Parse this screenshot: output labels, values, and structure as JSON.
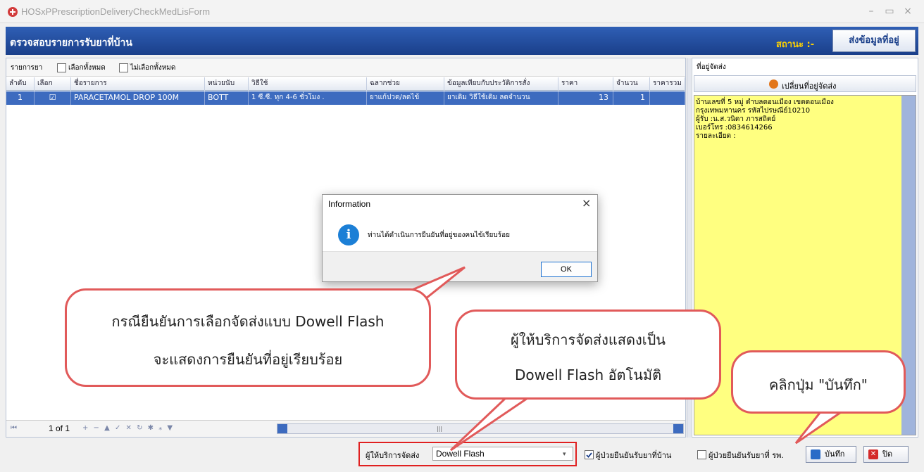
{
  "window": {
    "title": "HOSxPPrescriptionDeliveryCheckMedLisForm",
    "controls": [
      "–",
      "▭",
      "×"
    ]
  },
  "header": {
    "title": "ตรวจสอบรายการรับยาที่บ้าน",
    "status_label": "สถานะ :-",
    "send_button": "ส่งข้อมูลที่อยู่"
  },
  "left_panel": {
    "section_label": "รายการยา",
    "select_all": "เลือกทั้งหมด",
    "deselect_all": "ไม่เลือกทั้งหมด",
    "columns": [
      "ลำดับ",
      "เลือก",
      "ชื่อรายการ",
      "หน่วยนับ",
      "วิธีใช้",
      "ฉลากช่วย",
      "ข้อมูลเทียบกับประวัติการสั่ง",
      "ราคา",
      "จำนวน",
      "ราคารวม"
    ],
    "rows": [
      {
        "no": "1",
        "checked": "☑",
        "name": "PARACETAMOL DROP 100M",
        "unit": "BOTT",
        "usage": "1 ซี.ซี. ทุก 4-6 ชั่วโมง .",
        "label": "ยาแก้ปวด/ลดไข้",
        "history": "ยาเดิม วิธีใช้เดิม ลดจำนวน",
        "price": "13",
        "qty": "1",
        "total": ""
      }
    ],
    "navigator": {
      "first": "⏮",
      "page": "1 of 1",
      "icons": "+ − ▲ ✓ ✕ ↻ ✱ ⁎ ▼"
    },
    "scroll_thumb": "|||"
  },
  "right_panel": {
    "title": "ที่อยู่จัดส่ง",
    "change_button": "เปลี่ยนที่อยู่จัดส่ง",
    "address_lines": [
      "บ้านเลขที่ 5 หมู่   ตำบลดอนเมือง  เขตดอนเมือง",
      "กรุงเทพมหานคร รหัสไปรษณีย์10210",
      "ผู้รับ :น.ส.วนิดา ภารสถิตย์",
      "เบอร์โทร :0834614266",
      "รายละเอียด :"
    ]
  },
  "bottom": {
    "provider_label": "ผู้ให้บริการจัดส่ง",
    "provider_value": "Dowell Flash",
    "patient_confirm_home": "ผู้ป่วยยืนยันรับยาที่บ้าน",
    "patient_confirm_hospital": "ผู้ป่วยยืนยันรับยาที่ รพ.",
    "save_button": "บันทึก",
    "close_button": "ปิด"
  },
  "dialog": {
    "title": "Information",
    "message": "ท่านได้ดำเนินการยืนยันที่อยู่ของคนไข้เรียบร้อย",
    "ok": "OK",
    "close": "×"
  },
  "callouts": {
    "left_line1": "กรณียืนยันการเลือกจัดส่งแบบ Dowell Flash",
    "left_line2": "จะแสดงการยืนยันที่อยู่เรียบร้อย",
    "middle_line1": "ผู้ให้บริการจัดส่งแสดงเป็น",
    "middle_line2": "Dowell Flash อัตโนมัติ",
    "right": "คลิกปุ่ม \"บันทึก\""
  },
  "colors": {
    "header_blue": "#1a3f8a",
    "row_selected": "#3d6bbf",
    "address_bg": "#ffff80",
    "callout_border": "#e15a5a",
    "status_yellow": "#ffd200"
  }
}
